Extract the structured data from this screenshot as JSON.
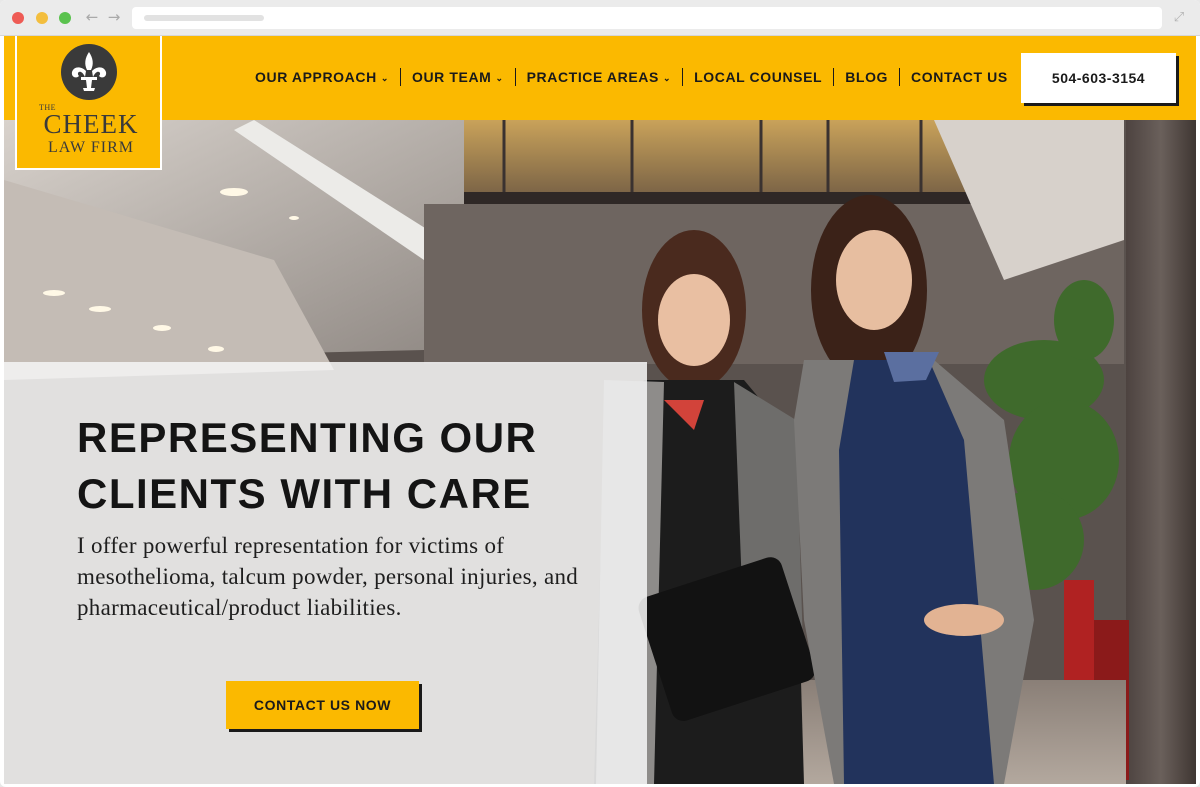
{
  "browser": {
    "back_icon": "arrow-left-icon",
    "forward_icon": "arrow-right-icon",
    "expand_icon": "expand-icon",
    "back_glyph": "←",
    "forward_glyph": "→",
    "expand_glyph": "⤢"
  },
  "header": {
    "logo": {
      "the": "THE",
      "name": "CHEEK",
      "subtitle": "LAW FIRM",
      "emblem_icon": "fleur-de-lis-icon"
    },
    "nav": [
      {
        "label": "OUR APPROACH",
        "has_dropdown": true
      },
      {
        "label": "OUR TEAM",
        "has_dropdown": true
      },
      {
        "label": "PRACTICE AREAS",
        "has_dropdown": true
      },
      {
        "label": "LOCAL COUNSEL",
        "has_dropdown": false
      },
      {
        "label": "BLOG",
        "has_dropdown": false
      },
      {
        "label": "CONTACT US",
        "has_dropdown": false
      }
    ],
    "caret_glyph": "⌄",
    "phone": "504-603-3154"
  },
  "hero": {
    "title": "REPRESENTING OUR CLIENTS WITH CARE",
    "copy": "I offer powerful representation for victims of mesothelioma, talcum powder, personal injuries, and pharmaceutical/product liabilities.",
    "cta": "CONTACT US NOW"
  },
  "colors": {
    "brand_yellow": "#fbb900",
    "text_dark": "#1a1a1a",
    "logo_gray": "#3a3a3a"
  }
}
